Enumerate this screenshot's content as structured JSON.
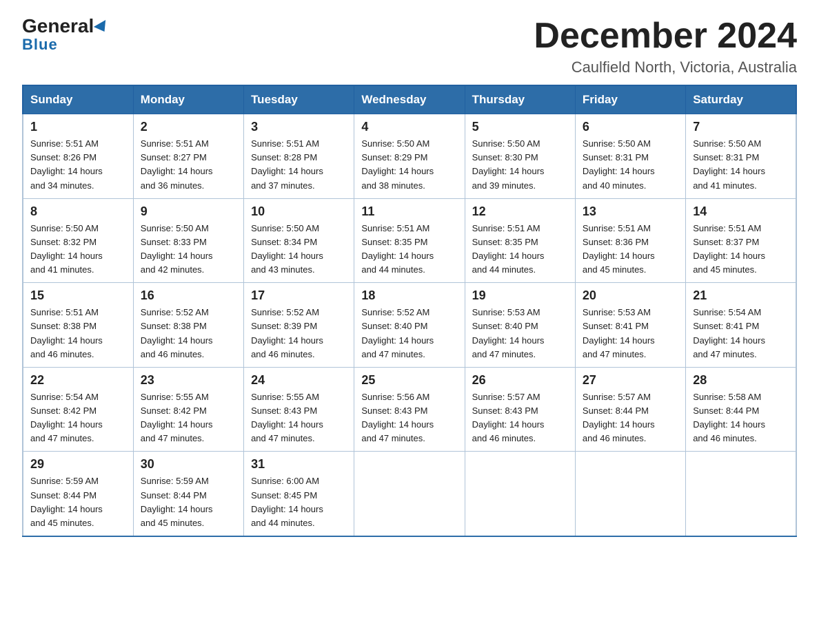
{
  "header": {
    "logo_general": "General",
    "logo_blue": "Blue",
    "month_title": "December 2024",
    "subtitle": "Caulfield North, Victoria, Australia"
  },
  "days_of_week": [
    "Sunday",
    "Monday",
    "Tuesday",
    "Wednesday",
    "Thursday",
    "Friday",
    "Saturday"
  ],
  "weeks": [
    [
      {
        "day": "1",
        "info": "Sunrise: 5:51 AM\nSunset: 8:26 PM\nDaylight: 14 hours\nand 34 minutes."
      },
      {
        "day": "2",
        "info": "Sunrise: 5:51 AM\nSunset: 8:27 PM\nDaylight: 14 hours\nand 36 minutes."
      },
      {
        "day": "3",
        "info": "Sunrise: 5:51 AM\nSunset: 8:28 PM\nDaylight: 14 hours\nand 37 minutes."
      },
      {
        "day": "4",
        "info": "Sunrise: 5:50 AM\nSunset: 8:29 PM\nDaylight: 14 hours\nand 38 minutes."
      },
      {
        "day": "5",
        "info": "Sunrise: 5:50 AM\nSunset: 8:30 PM\nDaylight: 14 hours\nand 39 minutes."
      },
      {
        "day": "6",
        "info": "Sunrise: 5:50 AM\nSunset: 8:31 PM\nDaylight: 14 hours\nand 40 minutes."
      },
      {
        "day": "7",
        "info": "Sunrise: 5:50 AM\nSunset: 8:31 PM\nDaylight: 14 hours\nand 41 minutes."
      }
    ],
    [
      {
        "day": "8",
        "info": "Sunrise: 5:50 AM\nSunset: 8:32 PM\nDaylight: 14 hours\nand 41 minutes."
      },
      {
        "day": "9",
        "info": "Sunrise: 5:50 AM\nSunset: 8:33 PM\nDaylight: 14 hours\nand 42 minutes."
      },
      {
        "day": "10",
        "info": "Sunrise: 5:50 AM\nSunset: 8:34 PM\nDaylight: 14 hours\nand 43 minutes."
      },
      {
        "day": "11",
        "info": "Sunrise: 5:51 AM\nSunset: 8:35 PM\nDaylight: 14 hours\nand 44 minutes."
      },
      {
        "day": "12",
        "info": "Sunrise: 5:51 AM\nSunset: 8:35 PM\nDaylight: 14 hours\nand 44 minutes."
      },
      {
        "day": "13",
        "info": "Sunrise: 5:51 AM\nSunset: 8:36 PM\nDaylight: 14 hours\nand 45 minutes."
      },
      {
        "day": "14",
        "info": "Sunrise: 5:51 AM\nSunset: 8:37 PM\nDaylight: 14 hours\nand 45 minutes."
      }
    ],
    [
      {
        "day": "15",
        "info": "Sunrise: 5:51 AM\nSunset: 8:38 PM\nDaylight: 14 hours\nand 46 minutes."
      },
      {
        "day": "16",
        "info": "Sunrise: 5:52 AM\nSunset: 8:38 PM\nDaylight: 14 hours\nand 46 minutes."
      },
      {
        "day": "17",
        "info": "Sunrise: 5:52 AM\nSunset: 8:39 PM\nDaylight: 14 hours\nand 46 minutes."
      },
      {
        "day": "18",
        "info": "Sunrise: 5:52 AM\nSunset: 8:40 PM\nDaylight: 14 hours\nand 47 minutes."
      },
      {
        "day": "19",
        "info": "Sunrise: 5:53 AM\nSunset: 8:40 PM\nDaylight: 14 hours\nand 47 minutes."
      },
      {
        "day": "20",
        "info": "Sunrise: 5:53 AM\nSunset: 8:41 PM\nDaylight: 14 hours\nand 47 minutes."
      },
      {
        "day": "21",
        "info": "Sunrise: 5:54 AM\nSunset: 8:41 PM\nDaylight: 14 hours\nand 47 minutes."
      }
    ],
    [
      {
        "day": "22",
        "info": "Sunrise: 5:54 AM\nSunset: 8:42 PM\nDaylight: 14 hours\nand 47 minutes."
      },
      {
        "day": "23",
        "info": "Sunrise: 5:55 AM\nSunset: 8:42 PM\nDaylight: 14 hours\nand 47 minutes."
      },
      {
        "day": "24",
        "info": "Sunrise: 5:55 AM\nSunset: 8:43 PM\nDaylight: 14 hours\nand 47 minutes."
      },
      {
        "day": "25",
        "info": "Sunrise: 5:56 AM\nSunset: 8:43 PM\nDaylight: 14 hours\nand 47 minutes."
      },
      {
        "day": "26",
        "info": "Sunrise: 5:57 AM\nSunset: 8:43 PM\nDaylight: 14 hours\nand 46 minutes."
      },
      {
        "day": "27",
        "info": "Sunrise: 5:57 AM\nSunset: 8:44 PM\nDaylight: 14 hours\nand 46 minutes."
      },
      {
        "day": "28",
        "info": "Sunrise: 5:58 AM\nSunset: 8:44 PM\nDaylight: 14 hours\nand 46 minutes."
      }
    ],
    [
      {
        "day": "29",
        "info": "Sunrise: 5:59 AM\nSunset: 8:44 PM\nDaylight: 14 hours\nand 45 minutes."
      },
      {
        "day": "30",
        "info": "Sunrise: 5:59 AM\nSunset: 8:44 PM\nDaylight: 14 hours\nand 45 minutes."
      },
      {
        "day": "31",
        "info": "Sunrise: 6:00 AM\nSunset: 8:45 PM\nDaylight: 14 hours\nand 44 minutes."
      },
      {
        "day": "",
        "info": ""
      },
      {
        "day": "",
        "info": ""
      },
      {
        "day": "",
        "info": ""
      },
      {
        "day": "",
        "info": ""
      }
    ]
  ]
}
